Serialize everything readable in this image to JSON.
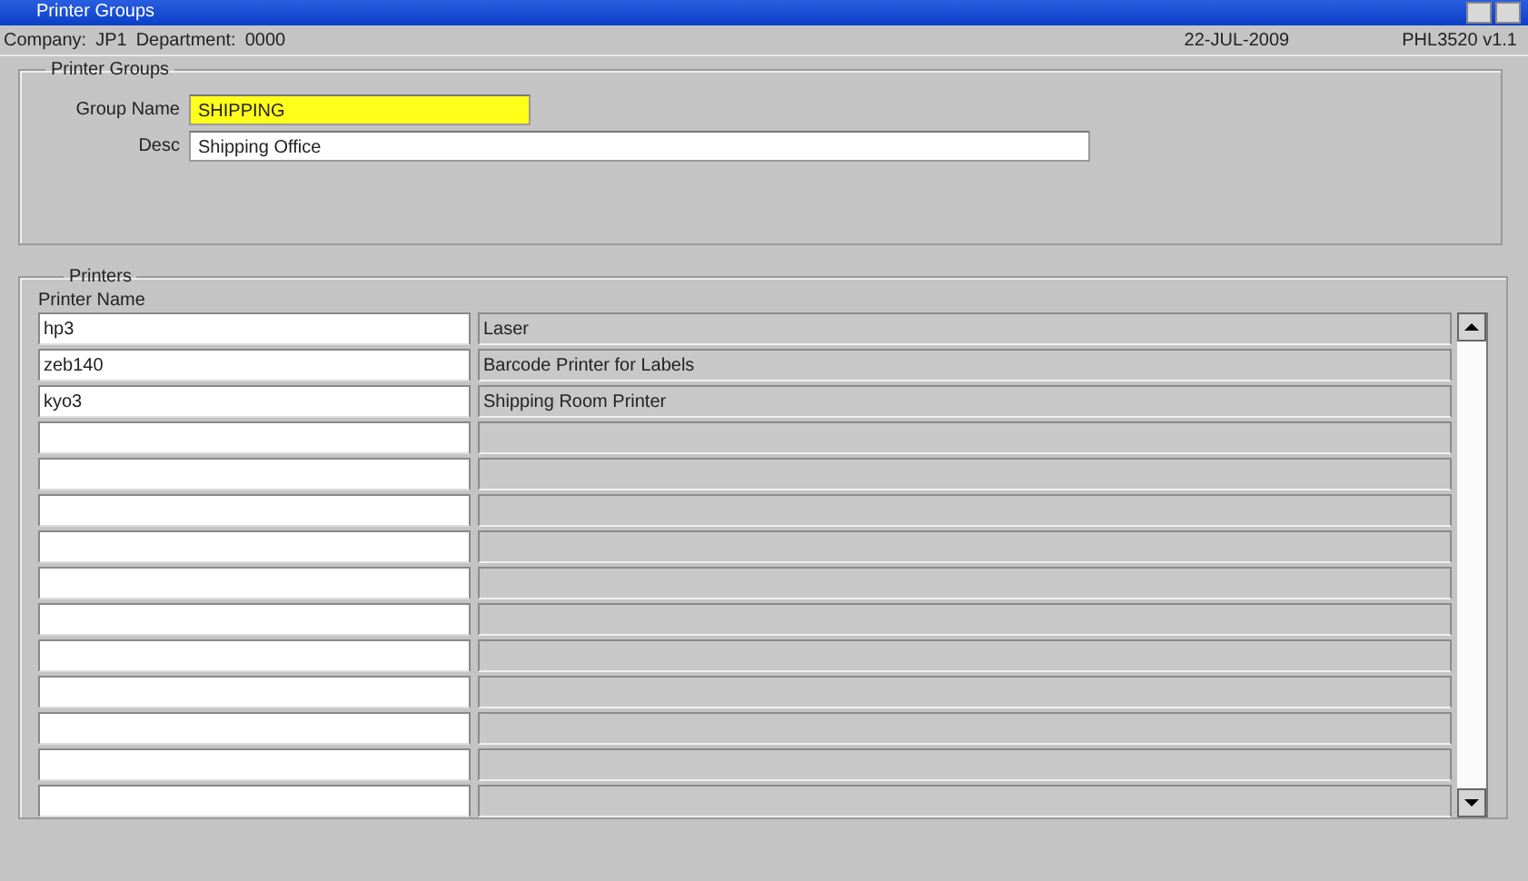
{
  "window": {
    "title": "Printer Groups"
  },
  "header": {
    "company_label": "Company:",
    "company": "JP1",
    "department_label": "Department:",
    "department": "0000",
    "date": "22-JUL-2009",
    "version": "PHL3520  v1.1"
  },
  "printer_groups": {
    "legend": "Printer Groups",
    "fields": [
      {
        "label": "Group Name",
        "value": "SHIPPING",
        "highlighted": true
      },
      {
        "label": "Desc",
        "value": "Shipping Office",
        "highlighted": false
      }
    ]
  },
  "printers": {
    "legend": "Printers",
    "column_1": "Printer Name",
    "rows": [
      {
        "name": "hp3",
        "description": "Laser"
      },
      {
        "name": "zeb140",
        "description": "Barcode Printer for Labels"
      },
      {
        "name": "kyo3",
        "description": "Shipping Room Printer"
      }
    ]
  }
}
